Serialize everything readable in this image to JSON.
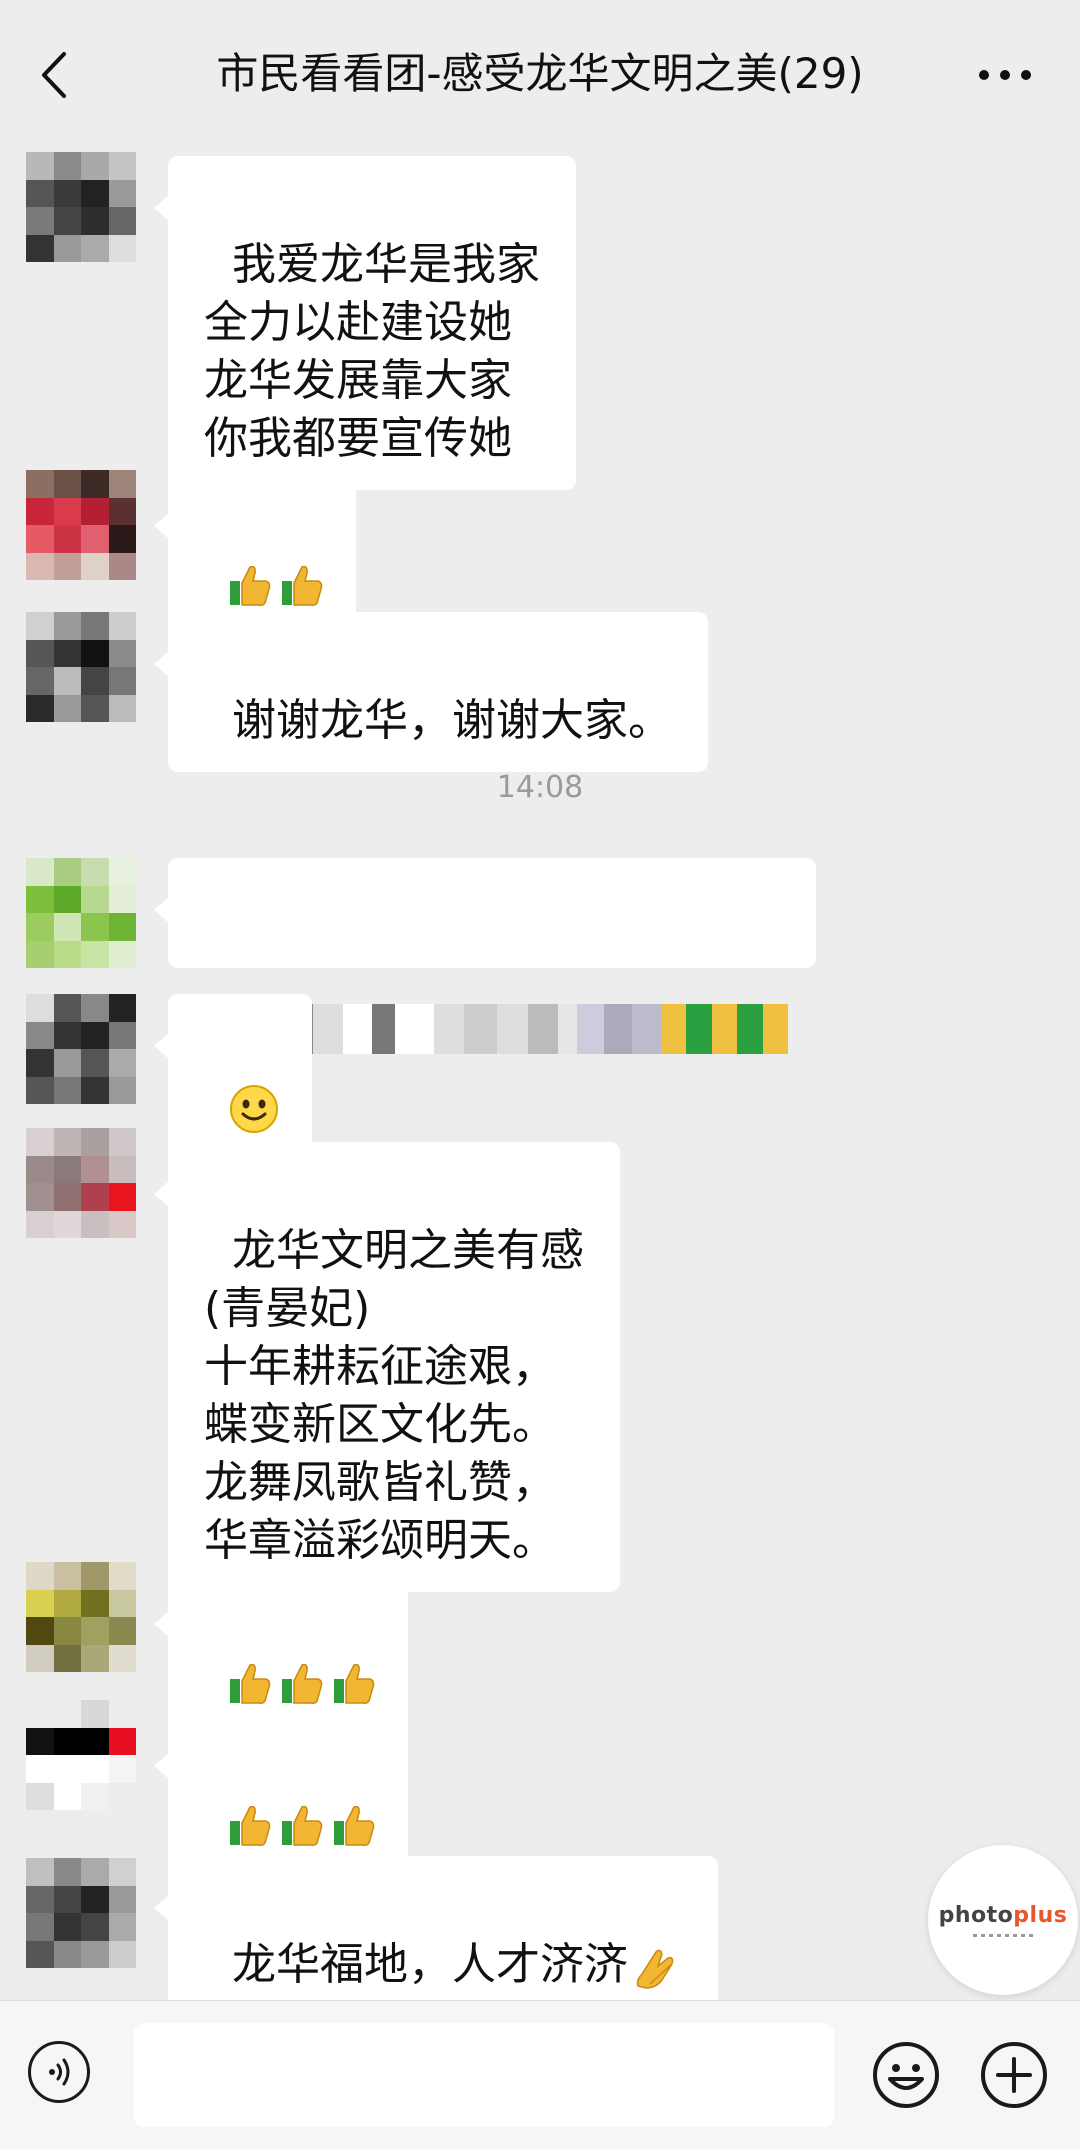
{
  "header": {
    "title": "市民看看团-感受龙华文明之美(29)",
    "back_icon": "chevron-left-icon",
    "more_icon": "more-dots-icon"
  },
  "messages": [
    {
      "type": "text",
      "text": "我爱龙华是我家\n全力以赴建设她\n龙华发展靠大家\n你我都要宣传她"
    },
    {
      "type": "emoji",
      "emoji": "thumbs-up-icon",
      "count": 2
    },
    {
      "type": "text",
      "text": "谢谢龙华，谢谢大家。"
    },
    {
      "type": "blurred",
      "description": ""
    },
    {
      "type": "emoji",
      "emoji": "smiley-icon",
      "count": 1
    },
    {
      "type": "text",
      "text": "龙华文明之美有感\n(青晏妃)\n十年耕耘征途艰，\n蝶变新区文化先。\n龙舞凤歌皆礼赞，\n华章溢彩颂明天。"
    },
    {
      "type": "emoji",
      "emoji": "thumbs-up-icon",
      "count": 3
    },
    {
      "type": "emoji",
      "emoji": "thumbs-up-icon",
      "count": 3
    },
    {
      "type": "text",
      "text": "龙华福地，人才济济",
      "trailing_emoji": "pray-icon"
    }
  ],
  "timestamp": "14:08",
  "watermark": {
    "brand": "photoplus"
  },
  "bottom_bar": {
    "voice_icon": "voice-icon",
    "emoji_icon": "emoji-face-icon",
    "plus_icon": "plus-circle-icon",
    "input_placeholder": ""
  },
  "colors": {
    "background": "#ededed",
    "bubble": "#ffffff",
    "timestamp": "#9a9a9a"
  }
}
